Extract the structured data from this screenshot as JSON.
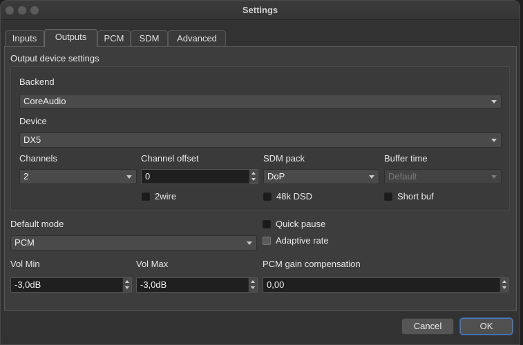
{
  "window": {
    "title": "Settings"
  },
  "tabs": [
    {
      "label": "Inputs"
    },
    {
      "label": "Outputs"
    },
    {
      "label": "PCM"
    },
    {
      "label": "SDM"
    },
    {
      "label": "Advanced"
    }
  ],
  "group": {
    "title": "Output device settings",
    "backend": {
      "label": "Backend",
      "value": "CoreAudio"
    },
    "device": {
      "label": "Device",
      "value": "DX5"
    },
    "channels": {
      "label": "Channels",
      "value": "2"
    },
    "channel_offset": {
      "label": "Channel offset",
      "value": "0"
    },
    "sdm_pack": {
      "label": "SDM pack",
      "value": "DoP"
    },
    "buffer_time": {
      "label": "Buffer time",
      "value": "Default"
    },
    "checks": {
      "twowire": "2wire",
      "dsd48k": "48k DSD",
      "short_buf": "Short buf"
    }
  },
  "default_mode": {
    "label": "Default mode",
    "value": "PCM"
  },
  "side_checks": {
    "quick_pause": "Quick pause",
    "adaptive_rate": "Adaptive rate"
  },
  "vol_min": {
    "label": "Vol Min",
    "value": "-3,0dB"
  },
  "vol_max": {
    "label": "Vol Max",
    "value": "-3,0dB"
  },
  "pcm_gain": {
    "label": "PCM gain compensation",
    "value": "0,00"
  },
  "buttons": {
    "cancel": "Cancel",
    "ok": "OK"
  }
}
